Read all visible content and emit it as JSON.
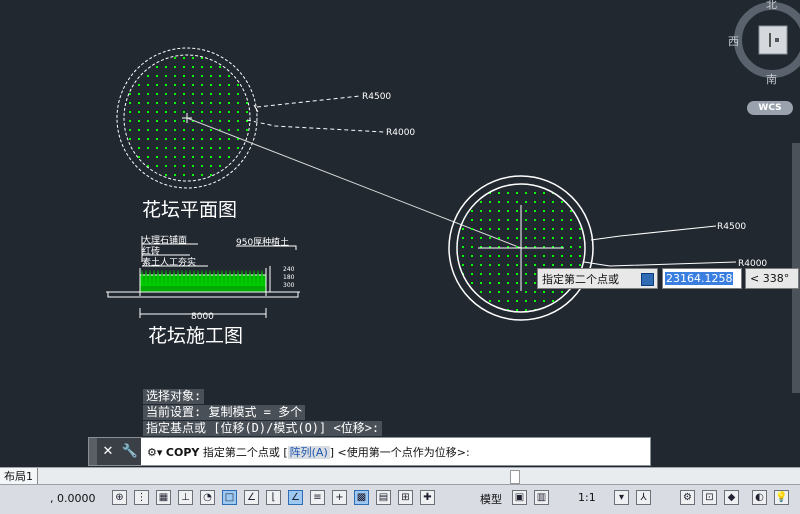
{
  "drawing": {
    "plan_title": "花坛平面图",
    "section_title": "花坛施工图",
    "left_circle_labels": {
      "outer": "R4500",
      "inner": "R4000"
    },
    "right_circle_labels": {
      "outer": "R4500",
      "inner": "R4000"
    },
    "section_labels": {
      "marble": "大理石铺面",
      "brick": "红砖",
      "soil": "素土人工夯实",
      "planting": "950厚种植土",
      "width": "8000",
      "dim_a": "240",
      "dim_b": "180",
      "dim_c": "300"
    }
  },
  "command_history": [
    "选择对象:",
    "当前设置:  复制模式 = 多个",
    "指定基点或 [位移(D)/模式(O)] <位移>:"
  ],
  "command_line": {
    "command": "COPY",
    "prompt": "指定第二个点或",
    "bracket_open": "[",
    "option": "阵列(A)",
    "bracket_close": "]",
    "tail": "<使用第一个点作为位移>:"
  },
  "dynamic_input": {
    "prompt": "指定第二个点或",
    "distance": "23164.1258",
    "angle": "< 338°"
  },
  "viewcube": {
    "north": "北",
    "west": "西",
    "south": "南",
    "wcs": "WCS"
  },
  "layout_tab": "布局1",
  "status": {
    "coord": ", 0.0000",
    "model": "模型",
    "scale": "1:1"
  },
  "colors": {
    "background": "#212830",
    "hatch": "#00ff00",
    "linework": "#ffffff"
  }
}
